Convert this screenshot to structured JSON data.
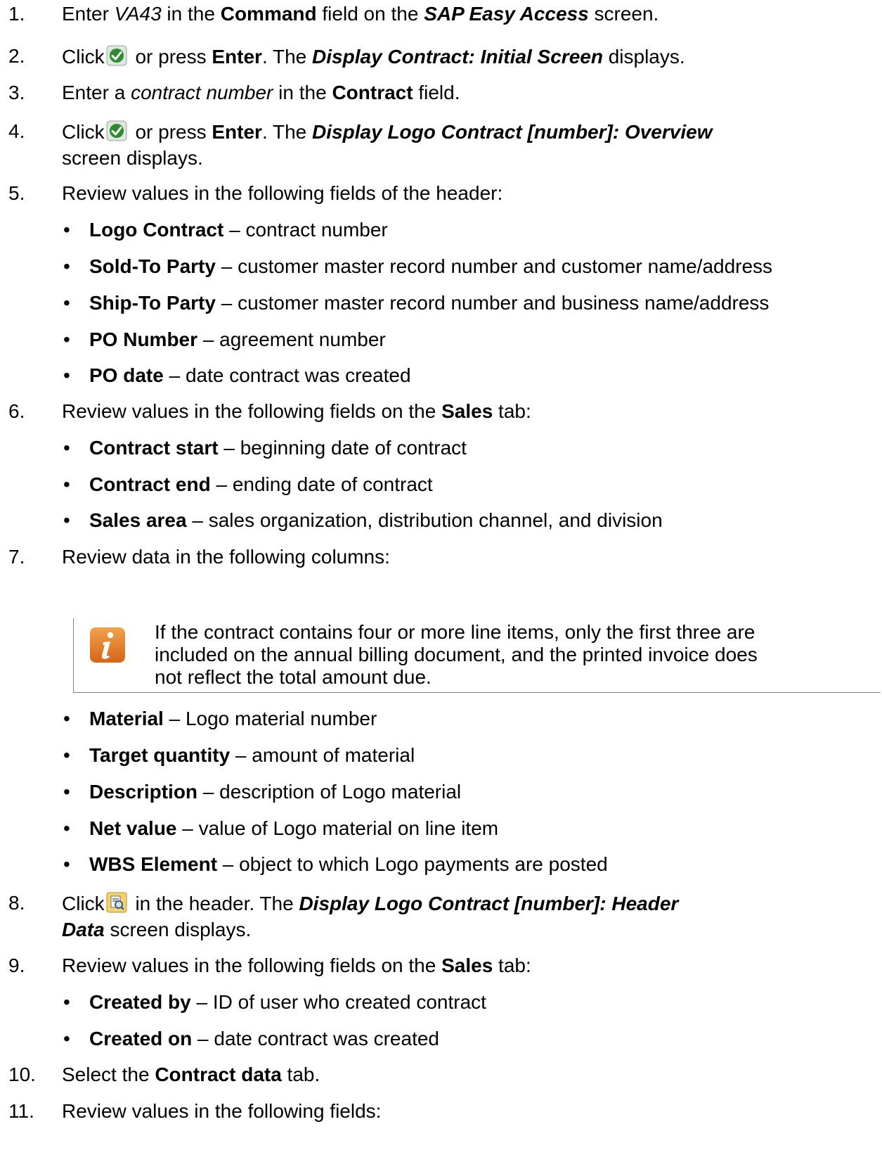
{
  "steps": [
    {
      "num": "1.",
      "parts": [
        "Enter ",
        "VA43",
        " in the ",
        "Command",
        " field on the ",
        "SAP Easy Access",
        " screen."
      ]
    },
    {
      "num": "2.",
      "parts": [
        "Click",
        " or press ",
        "Enter",
        ". The ",
        "Display Contract: Initial Screen",
        " displays."
      ]
    },
    {
      "num": "3.",
      "parts": [
        "Enter a ",
        "contract number",
        " in the ",
        "Contract",
        " field."
      ]
    },
    {
      "num": "4.",
      "parts": [
        "Click",
        " or press ",
        "Enter",
        ". The ",
        "Display Logo Contract [number]: Overview",
        "screen displays."
      ]
    },
    {
      "num": "5.",
      "text": "Review values in the following fields of the header:"
    },
    {
      "num": "6.",
      "parts": [
        "Review values in the following fields on the ",
        "Sales",
        " tab:"
      ]
    },
    {
      "num": "7.",
      "text": "Review data in the following columns:"
    },
    {
      "num": "8.",
      "parts": [
        "Click",
        " in the header. The ",
        "Display Logo Contract [number]: Header",
        "Data",
        " screen displays."
      ]
    },
    {
      "num": "9.",
      "parts": [
        "Review values in the following fields on the ",
        "Sales",
        " tab:"
      ]
    },
    {
      "num": "10.",
      "parts": [
        "Select the ",
        "Contract data",
        " tab."
      ]
    },
    {
      "num": "11.",
      "text": "Review values in the following fields:"
    }
  ],
  "bullets_header": [
    {
      "term": "Logo Contract",
      "desc": " – contract number"
    },
    {
      "term": "Sold-To Party",
      "desc": " – customer master record number and customer name/address"
    },
    {
      "term": "Ship-To Party",
      "desc": " – customer master record number and business name/address"
    },
    {
      "term": "PO Number",
      "desc": " – agreement number"
    },
    {
      "term": "PO date",
      "desc": " – date contract was created"
    }
  ],
  "bullets_sales": [
    {
      "term": "Contract start",
      "desc": " – beginning date of contract"
    },
    {
      "term": "Contract end",
      "desc": " – ending date of contract"
    },
    {
      "term": "Sales area",
      "desc": " – sales organization, distribution channel, and division"
    }
  ],
  "note": {
    "icon": "info-icon",
    "lines": [
      "If the contract contains four or more line items, only the first three are",
      "included on the annual billing document, and the printed invoice does",
      "not reflect the total amount due."
    ]
  },
  "bullets_columns": [
    {
      "term": "Material",
      "desc": " – Logo material number"
    },
    {
      "term": "Target quantity",
      "desc": " – amount of material"
    },
    {
      "term": "Description",
      "desc": " – description of Logo material"
    },
    {
      "term": "Net value",
      "desc": " – value of Logo material on line item"
    },
    {
      "term": "WBS Element",
      "desc": " – object to which Logo payments are posted"
    }
  ],
  "bullets_header_data": [
    {
      "term": "Created by",
      "desc": " – ID of user who created contract"
    },
    {
      "term": "Created on",
      "desc": " – date contract was created"
    }
  ],
  "bullet_char": "•",
  "icons": {
    "enter": "green-check-icon",
    "header": "header-details-icon"
  },
  "colors": {
    "check": "#2e8b2e",
    "note_icon": "#e07b24",
    "rule": "#7f7f7f"
  }
}
